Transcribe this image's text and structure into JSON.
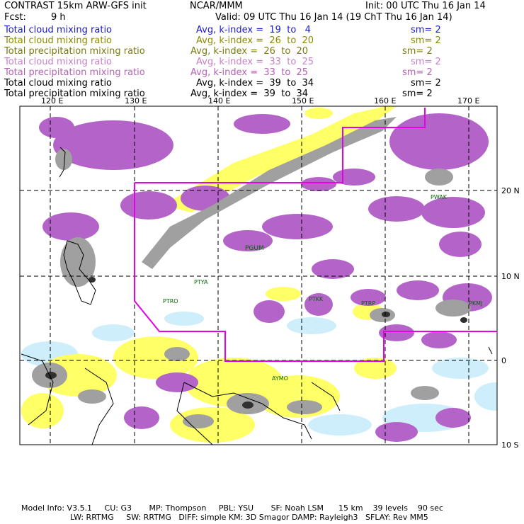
{
  "header": {
    "title": "CONTRAST 15km ARW-GFS init",
    "org": "NCAR/MMM",
    "init": "Init: 00 UTC Thu 16 Jan 14",
    "fcst_label": "Fcst:",
    "fcst_value": "9 h",
    "valid": "Valid: 09 UTC Thu 16 Jan 14 (19 ChT Thu 16 Jan 14)"
  },
  "fields": [
    {
      "name": "Total cloud mixing ratio",
      "avg": "Avg, k-index =  19  to   4",
      "sm": "sm= 2",
      "color": "#1a1acd"
    },
    {
      "name": "Total cloud mixing ratio",
      "avg": "Avg, k-index =  26  to  20",
      "sm": "sm= 2",
      "color": "#8b8b00"
    },
    {
      "name": "Total precipitation mixing ratio",
      "avg": "Avg, k-index =  26  to  20",
      "sm": "sm= 2",
      "color": "#7a7a10"
    },
    {
      "name": "Total cloud mixing ratio",
      "avg": "Avg, k-index =  33  to  25",
      "sm": "sm= 2",
      "color": "#c882c8"
    },
    {
      "name": "Total precipitation mixing ratio",
      "avg": "Avg, k-index =  33  to  25",
      "sm": "sm= 2",
      "color": "#b464b4"
    },
    {
      "name": "Total cloud mixing ratio",
      "avg": "Avg, k-index =  39  to  34",
      "sm": "sm= 2",
      "color": "#000000"
    },
    {
      "name": "Total precipitation mixing ratio",
      "avg": "Avg, k-index =  39  to  34",
      "sm": "sm= 2",
      "color": "#000000"
    }
  ],
  "lon_labels": [
    "120 E",
    "130 E",
    "140 E",
    "150 E",
    "160 E",
    "170 E"
  ],
  "lat_labels": [
    "20 N",
    "10 N",
    "0",
    "10 S"
  ],
  "stations": [
    "PWAK",
    "PGUM",
    "PTYA",
    "PTRO",
    "PTKK",
    "PTRP",
    "PKMJ",
    "AYMO"
  ],
  "model_info": {
    "line1": "Model Info: V3.5.1     CU: G3       MP: Thompson     PBL: YSU       SF: Noah LSM      15 km    39 levels    90 sec",
    "line2": "LW: RRTMG     SW: RRTMG   DIFF: simple KM: 3D Smagor DAMP: Rayleigh3   SFLAY: Rev MM5"
  },
  "colors": {
    "cloud_mid": "#b464c8",
    "cloud_high": "#a0a0a0",
    "precip_low": "#ffff66",
    "cloud_low": "#cdeefa",
    "domain_box": "#e600e6",
    "grid": "#000000"
  }
}
